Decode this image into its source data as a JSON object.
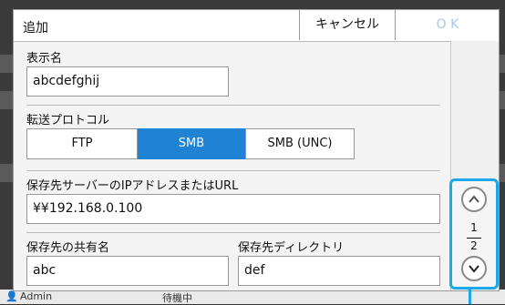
{
  "dialog": {
    "title": "追加",
    "cancel_label": "キャンセル",
    "ok_label": "O K"
  },
  "display_name": {
    "label": "表示名",
    "value": "abcdefghij"
  },
  "protocol": {
    "label": "転送プロトコル",
    "options": [
      "FTP",
      "SMB",
      "SMB (UNC)"
    ],
    "selected": "SMB"
  },
  "server": {
    "label": "保存先サーバーのIPアドレスまたはURL",
    "value": "¥¥192.168.0.100"
  },
  "share": {
    "label": "保存先の共有名",
    "value": "abc"
  },
  "directory": {
    "label": "保存先ディレクトリ",
    "value": "def"
  },
  "pager": {
    "current": "1",
    "total": "2"
  },
  "background": {
    "user_label": "Admin",
    "status_label": "待機中"
  },
  "colors": {
    "accent": "#1f82d2",
    "callout": "#1ca7e8",
    "ok_disabled": "#a8c7e8"
  }
}
